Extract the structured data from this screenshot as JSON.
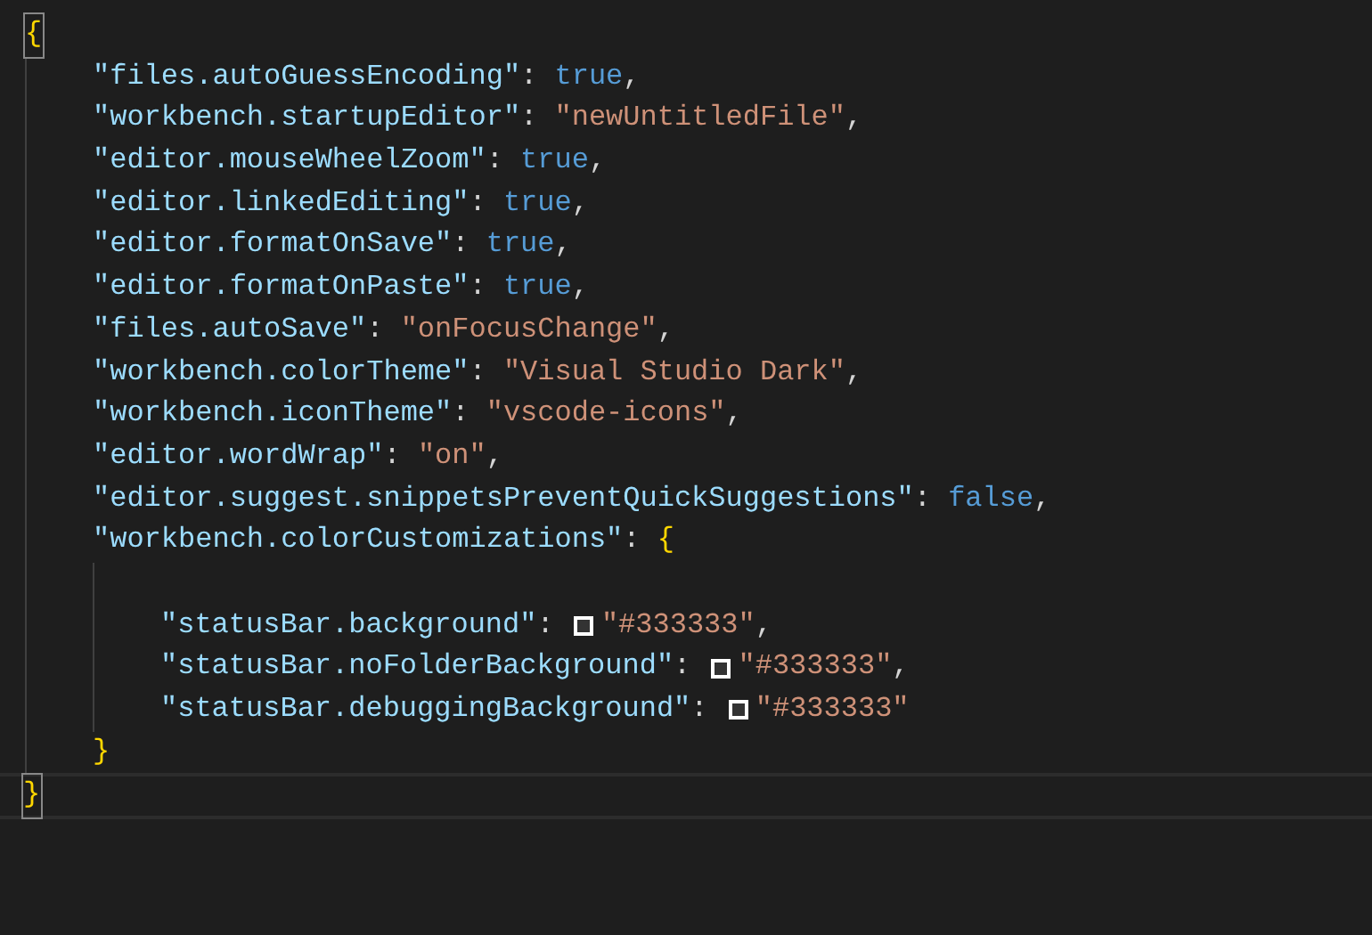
{
  "editor": {
    "lines": [
      {
        "current": false,
        "tokens": [
          {
            "kind": "brace",
            "text": "{",
            "highlighted": true
          }
        ],
        "children": [
          {
            "current": false,
            "tokens": [
              {
                "kind": "key",
                "text": "\"files.autoGuessEncoding\""
              },
              {
                "kind": "punct",
                "text": ": "
              },
              {
                "kind": "keyword",
                "text": "true"
              },
              {
                "kind": "punct",
                "text": ","
              }
            ]
          },
          {
            "current": false,
            "tokens": [
              {
                "kind": "key",
                "text": "\"workbench.startupEditor\""
              },
              {
                "kind": "punct",
                "text": ": "
              },
              {
                "kind": "string",
                "text": "\"newUntitledFile\""
              },
              {
                "kind": "punct",
                "text": ","
              }
            ]
          },
          {
            "current": false,
            "tokens": [
              {
                "kind": "key",
                "text": "\"editor.mouseWheelZoom\""
              },
              {
                "kind": "punct",
                "text": ": "
              },
              {
                "kind": "keyword",
                "text": "true"
              },
              {
                "kind": "punct",
                "text": ","
              }
            ]
          },
          {
            "current": false,
            "tokens": [
              {
                "kind": "key",
                "text": "\"editor.linkedEditing\""
              },
              {
                "kind": "punct",
                "text": ": "
              },
              {
                "kind": "keyword",
                "text": "true"
              },
              {
                "kind": "punct",
                "text": ","
              }
            ]
          },
          {
            "current": false,
            "tokens": [
              {
                "kind": "key",
                "text": "\"editor.formatOnSave\""
              },
              {
                "kind": "punct",
                "text": ": "
              },
              {
                "kind": "keyword",
                "text": "true"
              },
              {
                "kind": "punct",
                "text": ","
              }
            ]
          },
          {
            "current": false,
            "tokens": [
              {
                "kind": "key",
                "text": "\"editor.formatOnPaste\""
              },
              {
                "kind": "punct",
                "text": ": "
              },
              {
                "kind": "keyword",
                "text": "true"
              },
              {
                "kind": "punct",
                "text": ","
              }
            ]
          },
          {
            "current": false,
            "tokens": [
              {
                "kind": "key",
                "text": "\"files.autoSave\""
              },
              {
                "kind": "punct",
                "text": ": "
              },
              {
                "kind": "string",
                "text": "\"onFocusChange\""
              },
              {
                "kind": "punct",
                "text": ","
              }
            ]
          },
          {
            "current": false,
            "tokens": [
              {
                "kind": "key",
                "text": "\"workbench.colorTheme\""
              },
              {
                "kind": "punct",
                "text": ": "
              },
              {
                "kind": "string",
                "text": "\"Visual Studio Dark\""
              },
              {
                "kind": "punct",
                "text": ","
              }
            ]
          },
          {
            "current": false,
            "tokens": [
              {
                "kind": "key",
                "text": "\"workbench.iconTheme\""
              },
              {
                "kind": "punct",
                "text": ": "
              },
              {
                "kind": "string",
                "text": "\"vscode-icons\""
              },
              {
                "kind": "punct",
                "text": ","
              }
            ]
          },
          {
            "current": false,
            "tokens": [
              {
                "kind": "key",
                "text": "\"editor.wordWrap\""
              },
              {
                "kind": "punct",
                "text": ": "
              },
              {
                "kind": "string",
                "text": "\"on\""
              },
              {
                "kind": "punct",
                "text": ","
              }
            ]
          },
          {
            "current": false,
            "tokens": [
              {
                "kind": "key",
                "text": "\"editor.suggest.snippetsPreventQuickSuggestions\""
              },
              {
                "kind": "punct",
                "text": ": "
              },
              {
                "kind": "keyword",
                "text": "false"
              },
              {
                "kind": "punct",
                "text": ","
              }
            ]
          },
          {
            "current": false,
            "tokens": [
              {
                "kind": "key",
                "text": "\"workbench.colorCustomizations\""
              },
              {
                "kind": "punct",
                "text": ": "
              },
              {
                "kind": "brace",
                "text": "{",
                "highlighted": false
              }
            ],
            "children": [
              {
                "current": false
              },
              {
                "current": false,
                "tokens": [
                  {
                    "kind": "key",
                    "text": "\"statusBar.background\""
                  },
                  {
                    "kind": "punct",
                    "text": ": "
                  },
                  {
                    "kind": "swatch",
                    "color": "#333333"
                  },
                  {
                    "kind": "string",
                    "text": "\"#333333\""
                  },
                  {
                    "kind": "punct",
                    "text": ","
                  }
                ]
              },
              {
                "current": false,
                "tokens": [
                  {
                    "kind": "key",
                    "text": "\"statusBar.noFolderBackground\""
                  },
                  {
                    "kind": "punct",
                    "text": ": "
                  },
                  {
                    "kind": "swatch",
                    "color": "#333333"
                  },
                  {
                    "kind": "string",
                    "text": "\"#333333\""
                  },
                  {
                    "kind": "punct",
                    "text": ","
                  }
                ]
              },
              {
                "current": false,
                "tokens": [
                  {
                    "kind": "key",
                    "text": "\"statusBar.debuggingBackground\""
                  },
                  {
                    "kind": "punct",
                    "text": ": "
                  },
                  {
                    "kind": "swatch",
                    "color": "#333333"
                  },
                  {
                    "kind": "string",
                    "text": "\"#333333\""
                  }
                ]
              }
            ]
          },
          {
            "current": false,
            "tokens": [
              {
                "kind": "brace",
                "text": "}",
                "highlighted": false
              }
            ]
          }
        ]
      },
      {
        "current": true,
        "tokens": [
          {
            "kind": "brace",
            "text": "}",
            "highlighted": true
          }
        ]
      }
    ]
  }
}
